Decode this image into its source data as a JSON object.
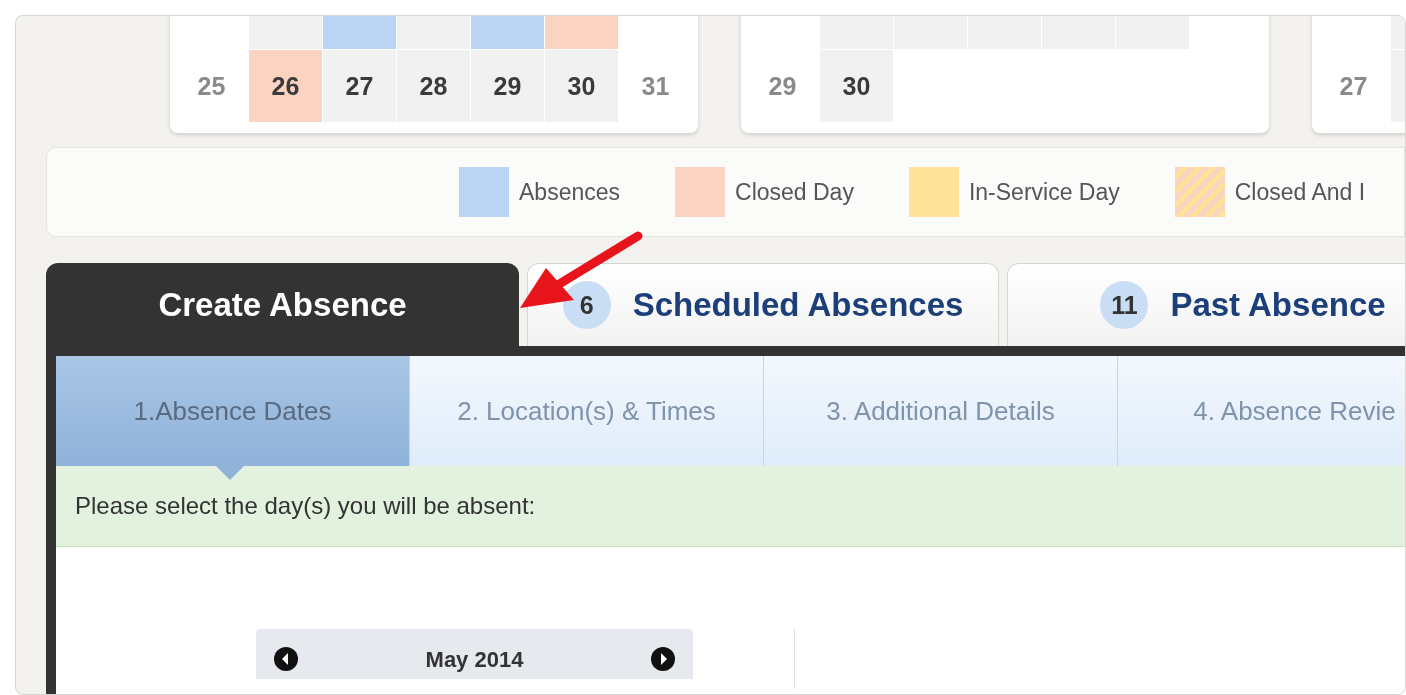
{
  "calendars": [
    {
      "weeks": [
        [
          {
            "kind": "weekend"
          },
          {
            "kind": "weekday"
          },
          {
            "kind": "absence"
          },
          {
            "kind": "weekday"
          },
          {
            "kind": "absence"
          },
          {
            "kind": "closed"
          },
          {
            "kind": "weekend"
          }
        ],
        [
          {
            "day": "25",
            "kind": "weekend"
          },
          {
            "day": "26",
            "kind": "closed"
          },
          {
            "day": "27",
            "kind": "weekday"
          },
          {
            "day": "28",
            "kind": "weekday"
          },
          {
            "day": "29",
            "kind": "weekday"
          },
          {
            "day": "30",
            "kind": "weekday"
          },
          {
            "day": "31",
            "kind": "weekend"
          }
        ]
      ]
    },
    {
      "weeks": [
        [
          {
            "kind": "weekend"
          },
          {
            "kind": "weekday"
          },
          {
            "kind": "weekday"
          },
          {
            "kind": "weekday"
          },
          {
            "kind": "weekday"
          },
          {
            "kind": "weekday"
          },
          {
            "kind": "weekend"
          }
        ],
        [
          {
            "day": "29",
            "kind": "weekend"
          },
          {
            "day": "30",
            "kind": "weekday"
          }
        ]
      ]
    },
    {
      "weeks": [
        [
          {
            "kind": "weekend"
          },
          {
            "kind": "weekday"
          }
        ],
        [
          {
            "day": "27",
            "kind": "weekend"
          },
          {
            "kind": "weekday"
          }
        ]
      ]
    }
  ],
  "legend": [
    {
      "label": "Absences",
      "color": "#b9d5f3",
      "kind": "solid"
    },
    {
      "label": "Closed Day",
      "color": "#fbd3c1",
      "kind": "solid"
    },
    {
      "label": "In-Service Day",
      "color": "#fde39a",
      "kind": "solid"
    },
    {
      "label": "Closed And I",
      "color": "#fbd3c1",
      "kind": "hatched"
    }
  ],
  "tabs": [
    {
      "label": "Create Absence",
      "selected": true
    },
    {
      "label": "Scheduled Absences",
      "count": "6",
      "selected": false
    },
    {
      "label": "Past Absence",
      "count": "11",
      "selected": false
    }
  ],
  "steps": [
    {
      "label": "1.Absence Dates",
      "selected": true
    },
    {
      "label": "2. Location(s) & Times",
      "selected": false
    },
    {
      "label": "3. Additional Details",
      "selected": false
    },
    {
      "label": "4. Absence Revie",
      "selected": false
    }
  ],
  "instruction": "Please select the day(s) you will be absent:",
  "mini_calendar": {
    "month": "May 2014"
  }
}
